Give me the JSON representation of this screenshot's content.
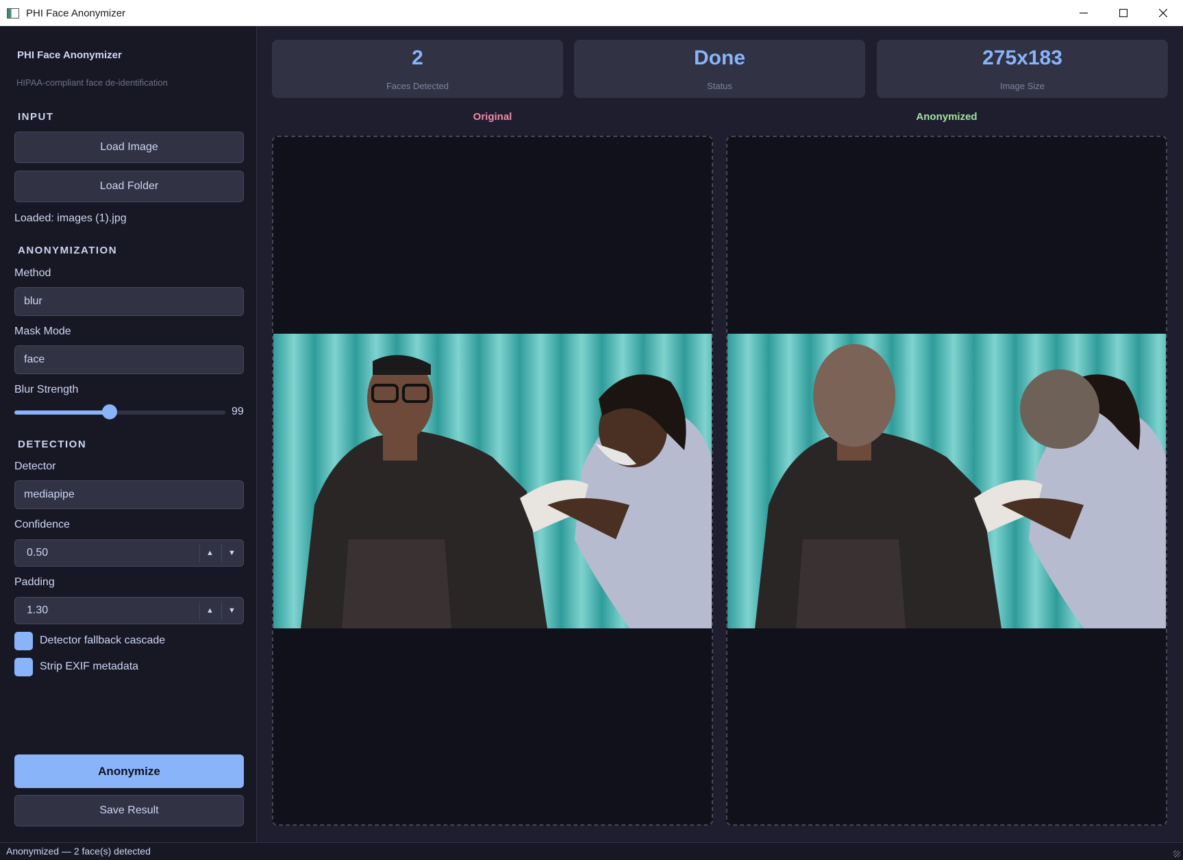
{
  "window": {
    "title": "PHI Face Anonymizer",
    "controls": [
      "minimize",
      "maximize",
      "close"
    ]
  },
  "sidebar": {
    "app_name": "PHI Face Anonymizer",
    "app_subtitle": "HIPAA-compliant face de-identification",
    "input": {
      "title": "INPUT",
      "load_image": "Load Image",
      "load_folder": "Load Folder",
      "loaded_text": "Loaded: images (1).jpg"
    },
    "anonymization": {
      "title": "ANONYMIZATION",
      "method_label": "Method",
      "method_value": "blur",
      "mask_mode_label": "Mask Mode",
      "mask_mode_value": "face",
      "blur_strength_label": "Blur Strength",
      "blur_strength_value": "99",
      "blur_slider_fraction": 0.45
    },
    "detection": {
      "title": "DETECTION",
      "detector_label": "Detector",
      "detector_value": "mediapipe",
      "confidence_label": "Confidence",
      "confidence_value": "0.50",
      "padding_label": "Padding",
      "padding_value": "1.30",
      "fallback_label": "Detector fallback cascade",
      "fallback_checked": true,
      "strip_exif_label": "Strip EXIF metadata",
      "strip_exif_checked": true
    },
    "actions": {
      "anonymize": "Anonymize",
      "save": "Save Result"
    }
  },
  "stats": [
    {
      "value": "2",
      "caption": "Faces Detected"
    },
    {
      "value": "Done",
      "caption": "Status"
    },
    {
      "value": "275x183",
      "caption": "Image Size"
    }
  ],
  "panels": {
    "original_title": "Original",
    "anonymized_title": "Anonymized"
  },
  "status_bar": {
    "text": "Anonymized — 2 face(s) detected"
  },
  "colors": {
    "accent": "#89b4fa",
    "original_title": "#f38ba8",
    "anonymized_title": "#a6e3a1",
    "background": "#1e1e2e",
    "sidebar": "#181825"
  }
}
